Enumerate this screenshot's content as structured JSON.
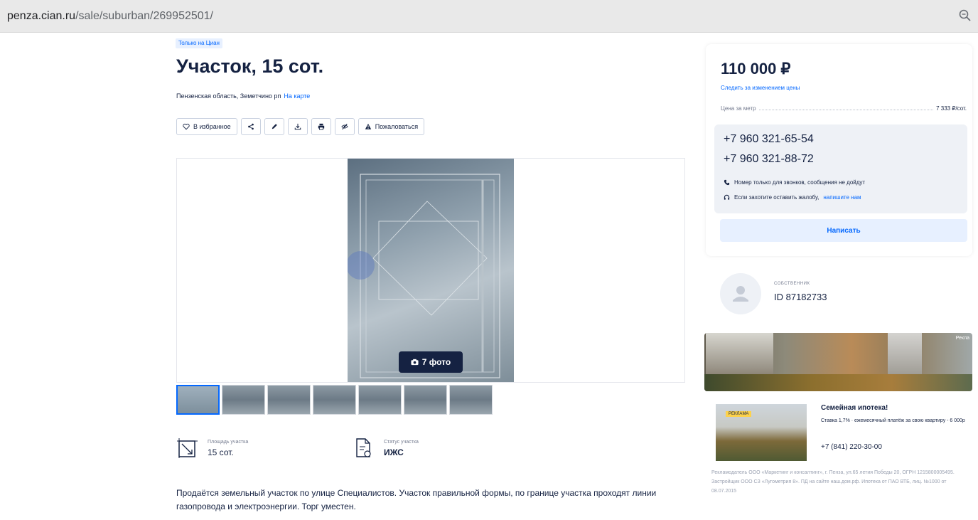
{
  "browser": {
    "url_host": "penza.cian.ru",
    "url_path": "/sale/suburban/269952501/"
  },
  "listing": {
    "badge": "Только на Циан",
    "title": "Участок, 15 сот.",
    "address": "Пензенская область, Земетчино рп",
    "map_link": "На карте"
  },
  "toolbar": {
    "favorite_label": "В избранное",
    "complain_label": "Пожаловаться"
  },
  "gallery": {
    "photo_count": "7 фото",
    "thumbnail_count": 7
  },
  "facts": [
    {
      "label": "Площадь участка",
      "value": "15 сот.",
      "icon": "area-icon"
    },
    {
      "label": "Статус участка",
      "value": "ИЖС",
      "icon": "document-icon"
    }
  ],
  "description": "Продаётся земельный участок по улице Специалистов. Участок правильной формы, по границе участка проходят линии газопровода и электроэнергии. Торг уместен.",
  "price": {
    "amount": "110 000 ₽",
    "follow_link": "Следить за изменением цены",
    "per_unit_label": "Цена за метр",
    "per_unit_value": "7 333 ₽/сот."
  },
  "contacts": {
    "phone1": "+7 960 321-65-54",
    "phone2": "+7 960 321-88-72",
    "note_calls": "Номер только для звонков, сообщения не дойдут",
    "note_complaint_prefix": "Если захотите оставить жалобу,",
    "note_complaint_link": "напишите нам",
    "write_button": "Написать"
  },
  "owner": {
    "role": "СОБСТВЕННИК",
    "id": "ID 87182733"
  },
  "ad_banner": {
    "tag": "Рекла"
  },
  "ad_card": {
    "label": "РЕКЛАМА",
    "title": "Семейная ипотека!",
    "description": "Ставка 1,7% · ежемесячный платёж за свою квартиру - 6 000р",
    "phone": "+7 (841) 220-30-00",
    "legal": "Рекламодатель ООО «Маркетинг и консалтинг», г. Пенза, ул.65 летия Победы 20, ОГРН 1215800005495. Застройщик ООО СЗ «Лугометрия 8». ПД на сайте наш.дом.рф. Ипотека от ПАО ВТБ, лиц. №1000 от 08.07.2015"
  },
  "colors": {
    "accent": "#0468ff",
    "text": "#152242",
    "muted": "#737a8e",
    "photo_badge": "#152242"
  }
}
